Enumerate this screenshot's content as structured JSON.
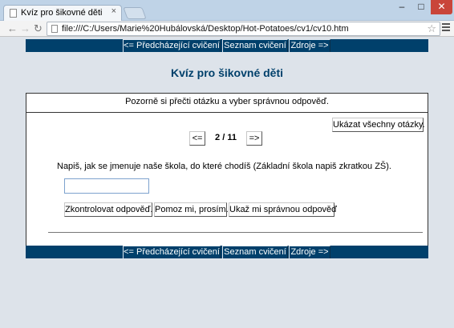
{
  "browser": {
    "tab_title": "Kvíz pro šikovné děti",
    "tab_close": "×",
    "window_controls": {
      "minimize": "–",
      "maximize": "□",
      "close": "✕"
    },
    "nav": {
      "back": "←",
      "forward": "→",
      "reload": "↻"
    },
    "url": "file:///C:/Users/Marie%20Hubálovská/Desktop/Hot-Potatoes/cv1/cv10.htm",
    "bookmark_star": "☆",
    "icons": {
      "back": "left-arrow-icon",
      "forward": "right-arrow-icon",
      "reload": "reload-icon",
      "menu": "menu-icon",
      "star": "star-icon"
    }
  },
  "top_nav": {
    "prev_exercise": "<= Předcházející cvičení",
    "exercise_list": "Seznam cvičení",
    "sources": "Zdroje =>"
  },
  "quiz": {
    "title": "Kvíz pro šikovné děti",
    "instruction": "Pozorně si přečti otázku a vyber správnou odpověď.",
    "show_all_button": "Ukázat všechny otázky.",
    "prev_question": "<=",
    "next_question": "=>",
    "counter": "2 / 11",
    "question": "Napiš, jak se jmenuje naše škola, do které chodíš (Základní škola napiš zkratkou ZŠ).",
    "answer_value": "",
    "check_button": "Zkontrolovat odpověď.",
    "hint_button": "Pomoz mi, prosím.",
    "show_answer_button": "Ukaž mi správnou odpověď"
  },
  "bottom_nav": {
    "prev_exercise": "<= Předcházející cvičení",
    "exercise_list": "Seznam cvičení",
    "sources": "Zdroje =>"
  },
  "colors": {
    "nav_bar": "#00406b",
    "title": "#00406b",
    "page_background": "#dde3ea",
    "chrome_titlebar": "#bfd3e7"
  }
}
